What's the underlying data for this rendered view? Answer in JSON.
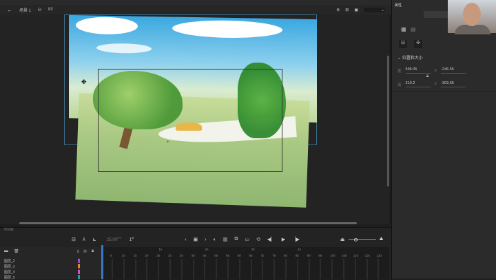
{
  "scene": {
    "back_icon": "arrow-left-icon",
    "scene_label": "场景 1",
    "zoom": "83"
  },
  "properties": {
    "tab": "属性",
    "section": "位置和大小",
    "width_label": "宽",
    "width": "596.05",
    "height_label": "高",
    "height": "310.2",
    "x_label": "X",
    "x": "-246.55",
    "y_label": "Y",
    "y": "-303.65"
  },
  "timeline": {
    "label": "时间轴",
    "fps": "25.00",
    "fps_unit": "FPS",
    "frame": "1",
    "frame_unit": "帧",
    "layers": [
      {
        "name": "图层_2",
        "color": "#9b4fcf"
      },
      {
        "name": "图层_3",
        "color": "#e08a2a"
      },
      {
        "name": "图层_4",
        "color": "#d24fd6"
      },
      {
        "name": "图层_5",
        "color": "#2a9d9a"
      }
    ],
    "frame_ticks": [
      "5",
      "10",
      "15",
      "20",
      "25",
      "30",
      "35",
      "40",
      "45",
      "50",
      "55",
      "60",
      "65",
      "70",
      "75",
      "80",
      "85",
      "90",
      "95",
      "100",
      "105",
      "110",
      "115",
      "120"
    ],
    "second_markers": [
      "1s",
      "2s",
      "3s",
      "4s"
    ]
  }
}
